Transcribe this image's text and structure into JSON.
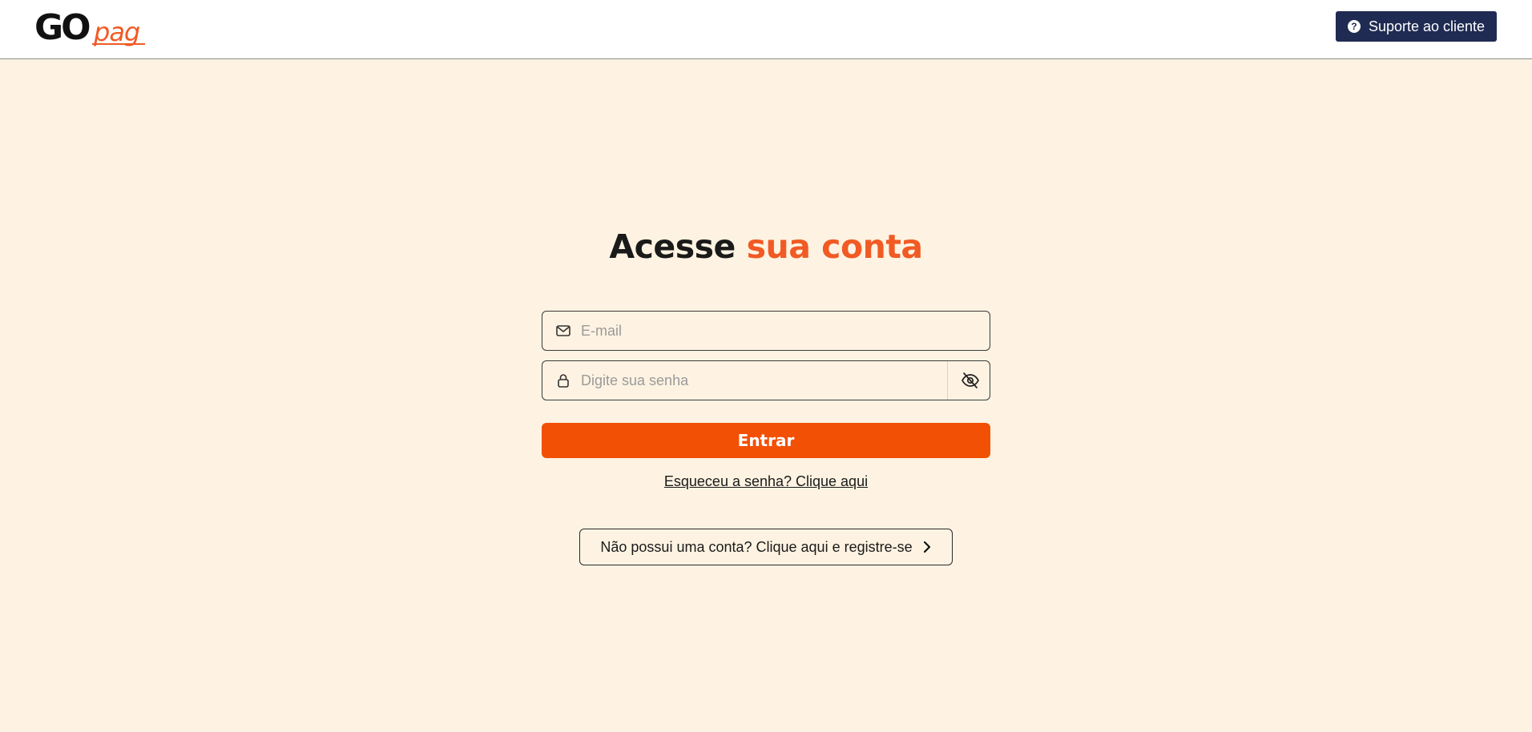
{
  "header": {
    "logo": {
      "part1": "GO",
      "part2": "pag"
    },
    "support_button": {
      "label": "Suporte ao cliente",
      "icon": "question-circle-icon"
    }
  },
  "login": {
    "title_part1": "Acesse",
    "title_part2": "sua conta",
    "email": {
      "placeholder": "E-mail",
      "value": "",
      "icon": "mail-icon"
    },
    "password": {
      "placeholder": "Digite sua senha",
      "value": "",
      "icon": "lock-icon",
      "toggle_icon": "eye-off-icon"
    },
    "submit_label": "Entrar",
    "forgot_label": "Esqueceu a senha? Clique aqui",
    "register_label": "Não possui uma conta? Clique aqui e registre-se",
    "register_icon": "chevron-right-icon"
  },
  "colors": {
    "background": "#fef3e2",
    "accent": "#f25005",
    "support_button": "#1f2b52"
  }
}
